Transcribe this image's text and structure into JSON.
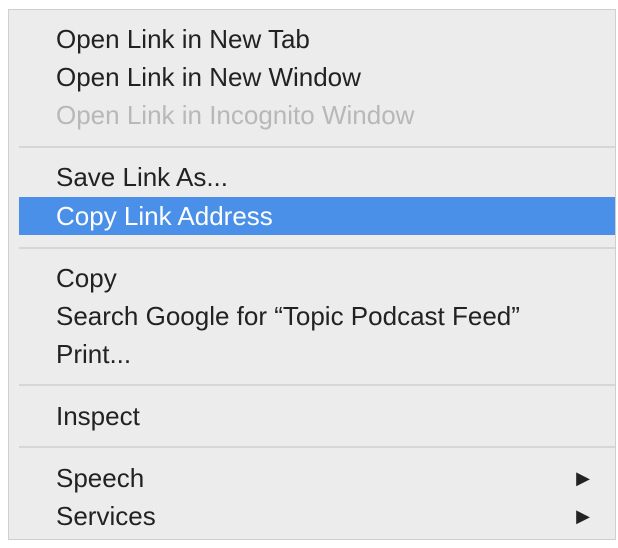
{
  "context_menu": {
    "group1": [
      {
        "label": "Open Link in New Tab"
      },
      {
        "label": "Open Link in New Window"
      },
      {
        "label": "Open Link in Incognito Window"
      }
    ],
    "group2": [
      {
        "label": "Save Link As..."
      },
      {
        "label": "Copy Link Address"
      }
    ],
    "group3": [
      {
        "label": "Copy"
      },
      {
        "label": "Search Google for “Topic Podcast Feed”"
      },
      {
        "label": "Print..."
      }
    ],
    "group4": [
      {
        "label": "Inspect"
      }
    ],
    "group5": [
      {
        "label": "Speech",
        "submenu_icon": "submenu-arrow-icon"
      },
      {
        "label": "Services",
        "submenu_icon": "submenu-arrow-icon"
      }
    ],
    "highlighted_color": "#4a90e8",
    "disabled_color": "#b8b8b8"
  }
}
